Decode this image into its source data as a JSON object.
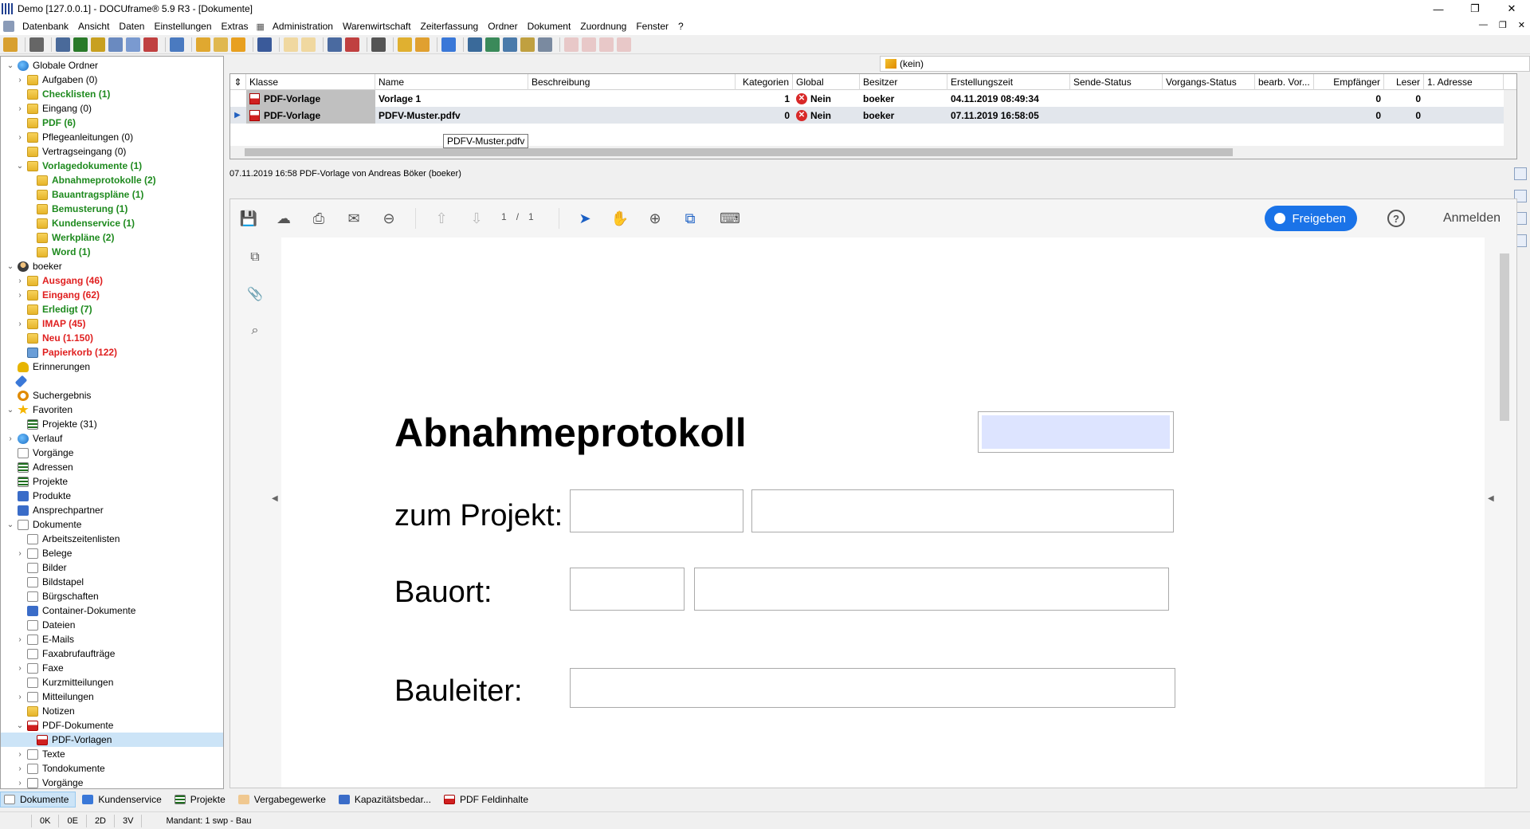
{
  "window": {
    "title": "Demo [127.0.0.1] - DOCUframe® 5.9 R3 - [Dokumente]",
    "buttons": [
      "—",
      "❐",
      "✕"
    ]
  },
  "menu": {
    "items": [
      "Datenbank",
      "Ansicht",
      "Daten",
      "Einstellungen",
      "Extras",
      "Administration",
      "Warenwirtschaft",
      "Zeiterfassung",
      "Ordner",
      "Dokument",
      "Zuordnung",
      "Fenster",
      "?"
    ],
    "mdi_buttons": [
      "—",
      "❐",
      "✕"
    ]
  },
  "tree": {
    "items": [
      {
        "label": "Globale Ordner",
        "toggle": "⌄",
        "icon": "globe-icon",
        "style": "normal",
        "indent": 0
      },
      {
        "label": "Aufgaben (0)",
        "toggle": "›",
        "icon": "folder-icon",
        "style": "normal",
        "indent": 1
      },
      {
        "label": "Checklisten (1)",
        "toggle": "",
        "icon": "folder-icon",
        "style": "green",
        "indent": 1
      },
      {
        "label": "Eingang (0)",
        "toggle": "›",
        "icon": "folder-icon",
        "style": "normal",
        "indent": 1
      },
      {
        "label": "PDF (6)",
        "toggle": "",
        "icon": "folder-icon",
        "style": "green",
        "indent": 1
      },
      {
        "label": "Pflegeanleitungen (0)",
        "toggle": "›",
        "icon": "folder-icon",
        "style": "normal",
        "indent": 1
      },
      {
        "label": "Vertragseingang (0)",
        "toggle": "",
        "icon": "folder-icon",
        "style": "normal",
        "indent": 1
      },
      {
        "label": "Vorlagedokumente (1)",
        "toggle": "⌄",
        "icon": "folder-icon",
        "style": "green",
        "indent": 1
      },
      {
        "label": "Abnahmeprotokolle (2)",
        "toggle": "",
        "icon": "folder-icon",
        "style": "green",
        "indent": 2
      },
      {
        "label": "Bauantragspläne (1)",
        "toggle": "",
        "icon": "folder-icon",
        "style": "green",
        "indent": 2
      },
      {
        "label": "Bemusterung (1)",
        "toggle": "",
        "icon": "folder-icon",
        "style": "green",
        "indent": 2
      },
      {
        "label": "Kundenservice (1)",
        "toggle": "",
        "icon": "folder-icon",
        "style": "green",
        "indent": 2
      },
      {
        "label": "Werkpläne (2)",
        "toggle": "",
        "icon": "folder-icon",
        "style": "green",
        "indent": 2
      },
      {
        "label": "Word (1)",
        "toggle": "",
        "icon": "folder-icon",
        "style": "green",
        "indent": 2
      },
      {
        "label": "boeker",
        "toggle": "⌄",
        "icon": "user-icon",
        "style": "normal",
        "indent": 0
      },
      {
        "label": "Ausgang (46)",
        "toggle": "›",
        "icon": "folder-icon",
        "style": "red",
        "indent": 1
      },
      {
        "label": "Eingang (62)",
        "toggle": "›",
        "icon": "folder-icon",
        "style": "red",
        "indent": 1
      },
      {
        "label": "Erledigt (7)",
        "toggle": "",
        "icon": "folder-icon",
        "style": "green",
        "indent": 1
      },
      {
        "label": "IMAP (45)",
        "toggle": "›",
        "icon": "folder-icon",
        "style": "red",
        "indent": 1
      },
      {
        "label": "Neu (1.150)",
        "toggle": "",
        "icon": "folder-icon",
        "style": "red",
        "indent": 1
      },
      {
        "label": "Papierkorb (122)",
        "toggle": "",
        "icon": "trash-icon",
        "style": "red",
        "indent": 1
      },
      {
        "label": "Erinnerungen",
        "toggle": "",
        "icon": "bell-icon",
        "style": "normal",
        "indent": 0
      },
      {
        "label": "",
        "toggle": "",
        "icon": "pin-icon",
        "style": "normal",
        "indent": 0
      },
      {
        "label": "Suchergebnis",
        "toggle": "",
        "icon": "search-icon",
        "style": "normal",
        "indent": 0
      },
      {
        "label": "Favoriten",
        "toggle": "⌄",
        "icon": "star-icon",
        "style": "normal",
        "indent": 0
      },
      {
        "label": "Projekte (31)",
        "toggle": "",
        "icon": "list-icon",
        "style": "normal",
        "indent": 1
      },
      {
        "label": "Verlauf",
        "toggle": "›",
        "icon": "globe-icon",
        "style": "normal",
        "indent": 0
      },
      {
        "label": "Vorgänge",
        "toggle": "",
        "icon": "doc-icon",
        "style": "normal",
        "indent": 0
      },
      {
        "label": "Adressen",
        "toggle": "",
        "icon": "list-icon",
        "style": "normal",
        "indent": 0
      },
      {
        "label": "Projekte",
        "toggle": "",
        "icon": "list-icon",
        "style": "normal",
        "indent": 0
      },
      {
        "label": "Produkte",
        "toggle": "",
        "icon": "blue-icon",
        "style": "normal",
        "indent": 0
      },
      {
        "label": "Ansprechpartner",
        "toggle": "",
        "icon": "blue-icon",
        "style": "normal",
        "indent": 0
      },
      {
        "label": "Dokumente",
        "toggle": "⌄",
        "icon": "doc-icon",
        "style": "normal",
        "indent": 0
      },
      {
        "label": "Arbeitszeitenlisten",
        "toggle": "",
        "icon": "doc-icon",
        "style": "normal",
        "indent": 1
      },
      {
        "label": "Belege",
        "toggle": "›",
        "icon": "doc-icon",
        "style": "normal",
        "indent": 1
      },
      {
        "label": "Bilder",
        "toggle": "",
        "icon": "doc-icon",
        "style": "normal",
        "indent": 1
      },
      {
        "label": "Bildstapel",
        "toggle": "",
        "icon": "doc-icon",
        "style": "normal",
        "indent": 1
      },
      {
        "label": "Bürgschaften",
        "toggle": "",
        "icon": "doc-icon",
        "style": "normal",
        "indent": 1
      },
      {
        "label": "Container-Dokumente",
        "toggle": "",
        "icon": "blue-icon",
        "style": "normal",
        "indent": 1
      },
      {
        "label": "Dateien",
        "toggle": "",
        "icon": "doc-icon",
        "style": "normal",
        "indent": 1
      },
      {
        "label": "E-Mails",
        "toggle": "›",
        "icon": "doc-icon",
        "style": "normal",
        "indent": 1
      },
      {
        "label": "Faxabrufaufträge",
        "toggle": "",
        "icon": "doc-icon",
        "style": "normal",
        "indent": 1
      },
      {
        "label": "Faxe",
        "toggle": "›",
        "icon": "doc-icon",
        "style": "normal",
        "indent": 1
      },
      {
        "label": "Kurzmitteilungen",
        "toggle": "",
        "icon": "doc-icon",
        "style": "normal",
        "indent": 1
      },
      {
        "label": "Mitteilungen",
        "toggle": "›",
        "icon": "doc-icon",
        "style": "normal",
        "indent": 1
      },
      {
        "label": "Notizen",
        "toggle": "",
        "icon": "folder-icon",
        "style": "normal",
        "indent": 1
      },
      {
        "label": "PDF-Dokumente",
        "toggle": "⌄",
        "icon": "pdf-icon",
        "style": "normal",
        "indent": 1
      },
      {
        "label": "PDF-Vorlagen",
        "toggle": "",
        "icon": "pdf-icon",
        "style": "selected",
        "indent": 2
      },
      {
        "label": "Texte",
        "toggle": "›",
        "icon": "doc-icon",
        "style": "normal",
        "indent": 1
      },
      {
        "label": "Tondokumente",
        "toggle": "›",
        "icon": "doc-icon",
        "style": "normal",
        "indent": 1
      },
      {
        "label": "Vorgänge",
        "toggle": "›",
        "icon": "doc-icon",
        "style": "normal",
        "indent": 1
      }
    ]
  },
  "filter": {
    "value": "(kein)"
  },
  "grid": {
    "columns": [
      "Klasse",
      "Name",
      "Beschreibung",
      "Kategorien",
      "Global",
      "Besitzer",
      "Erstellungszeit",
      "Sende-Status",
      "Vorgangs-Status",
      "bearb. Vor...",
      "Empfänger",
      "Leser",
      "1. Adresse"
    ],
    "rows": [
      {
        "klasse": "PDF-Vorlage",
        "name": "Vorlage 1",
        "beschreibung": "",
        "kategorien": "1",
        "global": "Nein",
        "besitzer": "boeker",
        "erstellungszeit": "04.11.2019 08:49:34",
        "empfaenger": "0",
        "leser": "0",
        "selected": false
      },
      {
        "klasse": "PDF-Vorlage",
        "name": "PDFV-Muster.pdfv",
        "beschreibung": "",
        "kategorien": "0",
        "global": "Nein",
        "besitzer": "boeker",
        "erstellungszeit": "07.11.2019 16:58:05",
        "empfaenger": "0",
        "leser": "0",
        "selected": true
      }
    ],
    "tooltip": "PDFV-Muster.pdfv"
  },
  "info_line": "07.11.2019 16:58 PDF-Vorlage von Andreas Böker (boeker)",
  "viewer": {
    "page_current": "1",
    "page_sep": "/",
    "page_total": "1",
    "share_label": "Freigeben",
    "help_label": "?",
    "login_label": "Anmelden",
    "icons": [
      "save-icon",
      "upload-icon",
      "print-icon",
      "mail-icon",
      "zoom-out-icon",
      "page-up-icon",
      "page-down-icon",
      "select-icon",
      "hand-icon",
      "zoom-in-icon",
      "fit-icon",
      "annotate-icon"
    ]
  },
  "document": {
    "title": "Abnahmeprotokoll",
    "label_projekt": "zum Projekt:",
    "label_bauort": "Bauort:",
    "label_bauleiter": "Bauleiter:"
  },
  "bottom_tabs": [
    {
      "label": "Dokumente",
      "active": true,
      "icon": "doc-icon"
    },
    {
      "label": "Kundenservice",
      "active": false,
      "icon": "pin-icon"
    },
    {
      "label": "Projekte",
      "active": false,
      "icon": "list-icon"
    },
    {
      "label": "Vergabegewerke",
      "active": false,
      "icon": "hand-icon"
    },
    {
      "label": "Kapazitätsbedar...",
      "active": false,
      "icon": "table-icon"
    },
    {
      "label": "PDF Feldinhalte",
      "active": false,
      "icon": "pdf-icon"
    }
  ],
  "status": {
    "cells": [
      "0K",
      "0E",
      "2D",
      "3V"
    ],
    "mandant": "Mandant: 1 swp - Bau"
  },
  "colors": {
    "accent": "#1a73e8",
    "green": "#1e8a1e",
    "red": "#e02020",
    "selection": "#cce4f7"
  }
}
